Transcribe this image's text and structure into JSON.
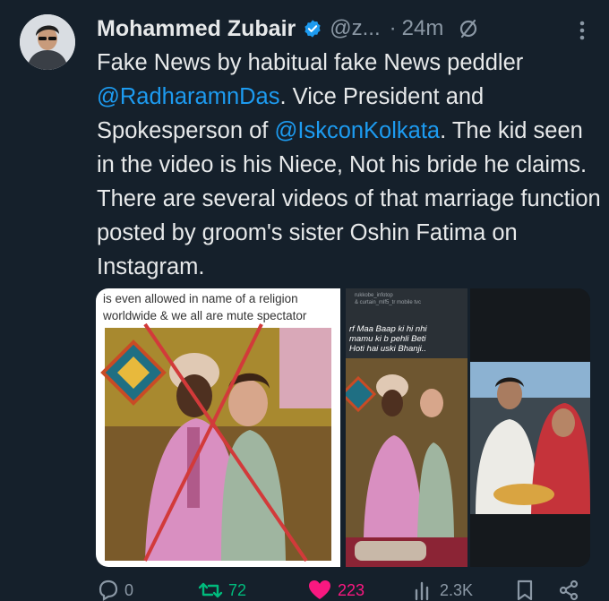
{
  "tweet": {
    "author_name": "Mohammed Zubair",
    "handle": "@z...",
    "separator": "·",
    "time": "24m",
    "text": {
      "p1": "Fake News by habitual fake News peddler ",
      "mention1": "@RadharamnDas",
      "p2": ". Vice President and Spokesperson of ",
      "mention2": "@IskconKolkata",
      "p3": ". The kid seen in the video is his Niece, Not his bride he claims. There are several videos of that marriage function posted by groom's sister Oshin Fatima on Instagram."
    }
  },
  "media": {
    "panel1_caption": "is even allowed in name of a religion\nworldwide & we all are mute spectator",
    "panel2_small_text": "rukkobe_infotop\n& curtain_mlf5_tr mobile tvc",
    "panel2_overlay": "rf Maa Baap ki hi nhi\nmamu ki b pehli Beti\nHoti hai uski Bhanji.."
  },
  "actions": {
    "reply_count": "0",
    "repost_count": "72",
    "like_count": "223",
    "views_count": "2.3K"
  },
  "colors": {
    "background": "#15202b",
    "text": "#e7e9ea",
    "secondary": "#8b98a5",
    "link": "#1d9bf0",
    "verified": "#1d9bf0",
    "repost": "#00ba7c",
    "like": "#f91880"
  },
  "icons": [
    "verified-icon",
    "grok-icon",
    "more-icon",
    "reply-icon",
    "repost-icon",
    "like-icon",
    "views-icon",
    "bookmark-icon",
    "share-icon"
  ]
}
